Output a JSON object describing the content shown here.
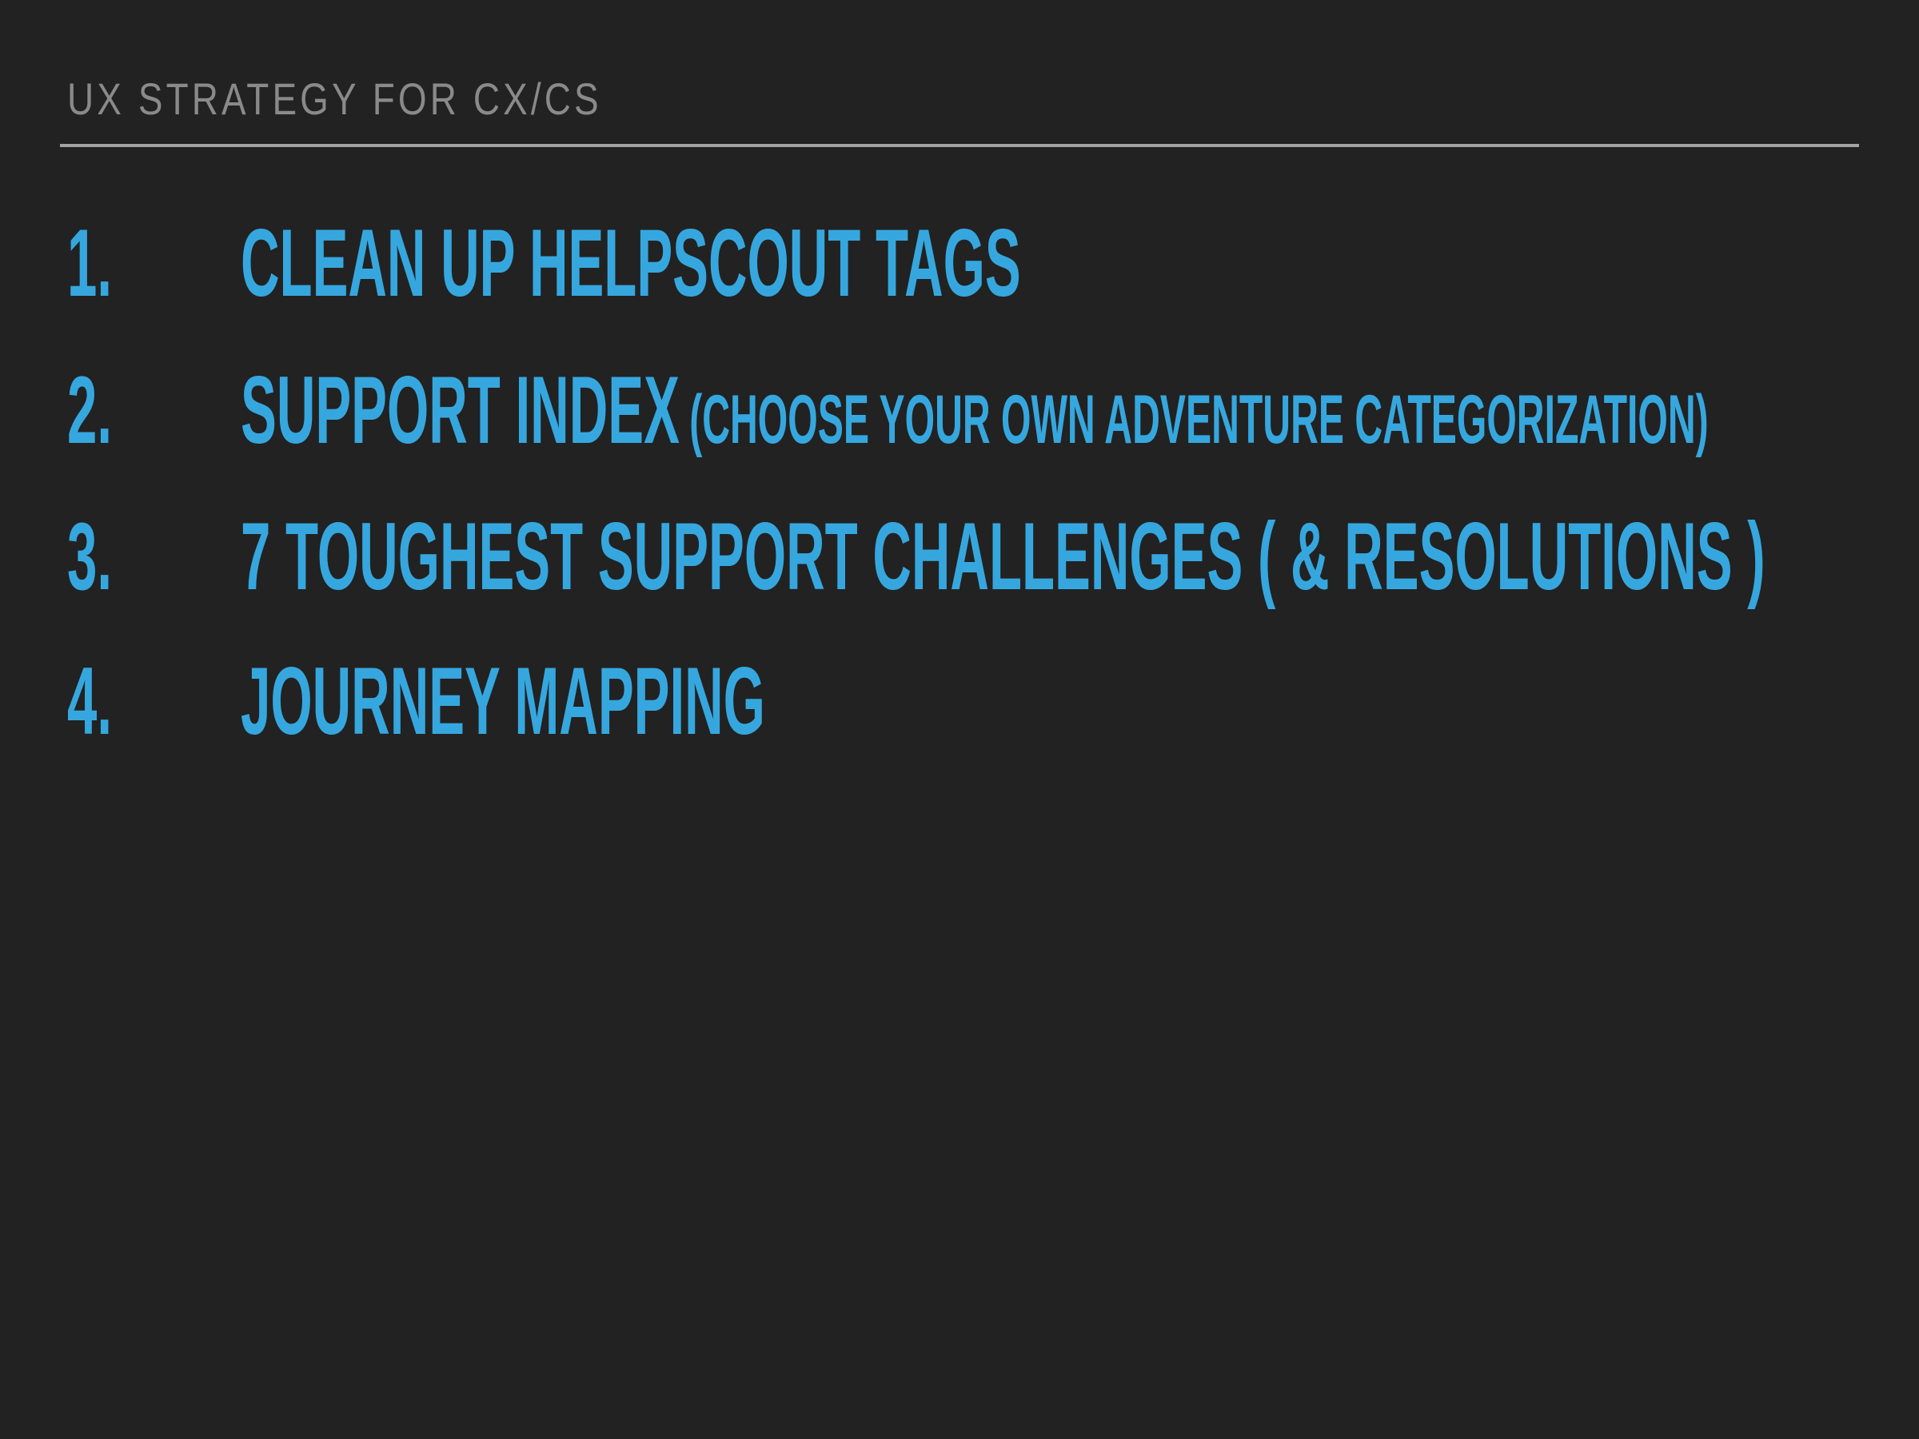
{
  "header": {
    "title": "UX STRATEGY FOR CX/CS"
  },
  "accent_color": "#36a7de",
  "items": [
    {
      "number": "1.",
      "text": "CLEAN UP HELPSCOUT TAGS"
    },
    {
      "number": "2.",
      "text": "SUPPORT INDEX",
      "subtext": "(CHOOSE YOUR OWN ADVENTURE CATEGORIZATION)"
    },
    {
      "number": "3.",
      "text": "7 TOUGHEST SUPPORT CHALLENGES ( & RESOLUTIONS )"
    },
    {
      "number": "4.",
      "text": "JOURNEY MAPPING"
    }
  ]
}
